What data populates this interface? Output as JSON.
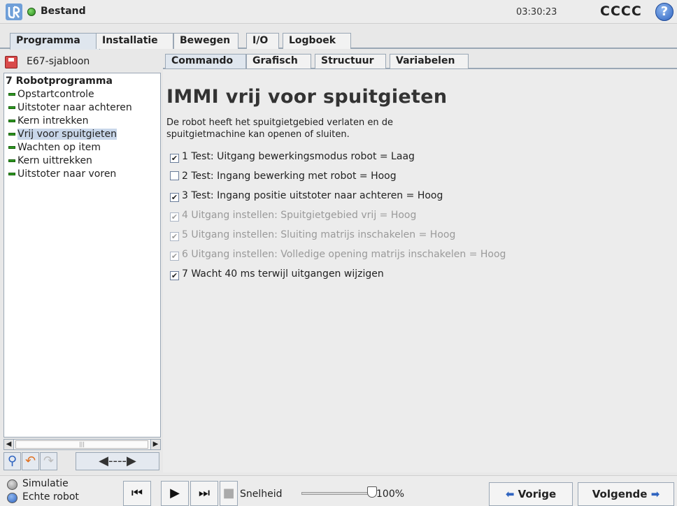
{
  "titlebar": {
    "logo": "ur-logo",
    "status_icon": "green-status-dot",
    "title": "Bestand",
    "clock": "03:30:23",
    "robot_name": "CCCC",
    "help_symbol": "?"
  },
  "main_tabs": [
    {
      "label": "Programma",
      "active": true
    },
    {
      "label": "Installatie",
      "active": false
    },
    {
      "label": "Bewegen",
      "active": false
    },
    {
      "label": "I/O",
      "active": false
    },
    {
      "label": "Logboek",
      "active": false
    }
  ],
  "program": {
    "file_name": "E67-sjabloon",
    "tree_root_marker": "7",
    "tree_root": "Robotprogramma",
    "tree_items": [
      {
        "label": "Opstartcontrole",
        "selected": false
      },
      {
        "label": "Uitstoter naar achteren",
        "selected": false
      },
      {
        "label": "Kern intrekken",
        "selected": false
      },
      {
        "label": "Vrij voor spuitgieten",
        "selected": true
      },
      {
        "label": "Wachten op item",
        "selected": false
      },
      {
        "label": "Kern uittrekken",
        "selected": false
      },
      {
        "label": "Uitstoter naar voren",
        "selected": false
      }
    ]
  },
  "content_tabs": [
    {
      "label": "Commando",
      "active": true
    },
    {
      "label": "Grafisch",
      "active": false
    },
    {
      "label": "Structuur",
      "active": false
    },
    {
      "label": "Variabelen",
      "active": false
    }
  ],
  "command": {
    "title": "IMMI vrij voor spuitgieten",
    "description": "De robot heeft het spuitgietgebied verlaten en de spuitgietmachine kan openen of sluiten.",
    "checks": [
      {
        "label": "1 Test: Uitgang bewerkingsmodus robot = Laag",
        "checked": true,
        "enabled": true
      },
      {
        "label": "2 Test: Ingang bewerking met robot = Hoog",
        "checked": false,
        "enabled": true
      },
      {
        "label": "3 Test: Ingang positie uitstoter naar achteren = Hoog",
        "checked": true,
        "enabled": true
      },
      {
        "label": "4 Uitgang instellen: Spuitgietgebied vrij = Hoog",
        "checked": true,
        "enabled": false
      },
      {
        "label": "5 Uitgang instellen: Sluiting matrijs inschakelen = Hoog",
        "checked": true,
        "enabled": false
      },
      {
        "label": "6 Uitgang instellen: Volledige opening matrijs inschakelen = Hoog",
        "checked": true,
        "enabled": false
      },
      {
        "label": "7 Wacht 40 ms terwijl uitgangen wijzigen",
        "checked": true,
        "enabled": true
      }
    ]
  },
  "footer": {
    "mode_simulation": "Simulatie",
    "mode_real": "Echte robot",
    "speed_label": "Snelheid",
    "speed_value": "100%",
    "speed_fraction": 1.0,
    "prev_label": "Vorige",
    "next_label": "Volgende"
  },
  "colors": {
    "accent_blue": "#2f64c0",
    "status_green": "#2d9a20",
    "selection": "#c9d7ea",
    "border": "#9aa7b5"
  }
}
